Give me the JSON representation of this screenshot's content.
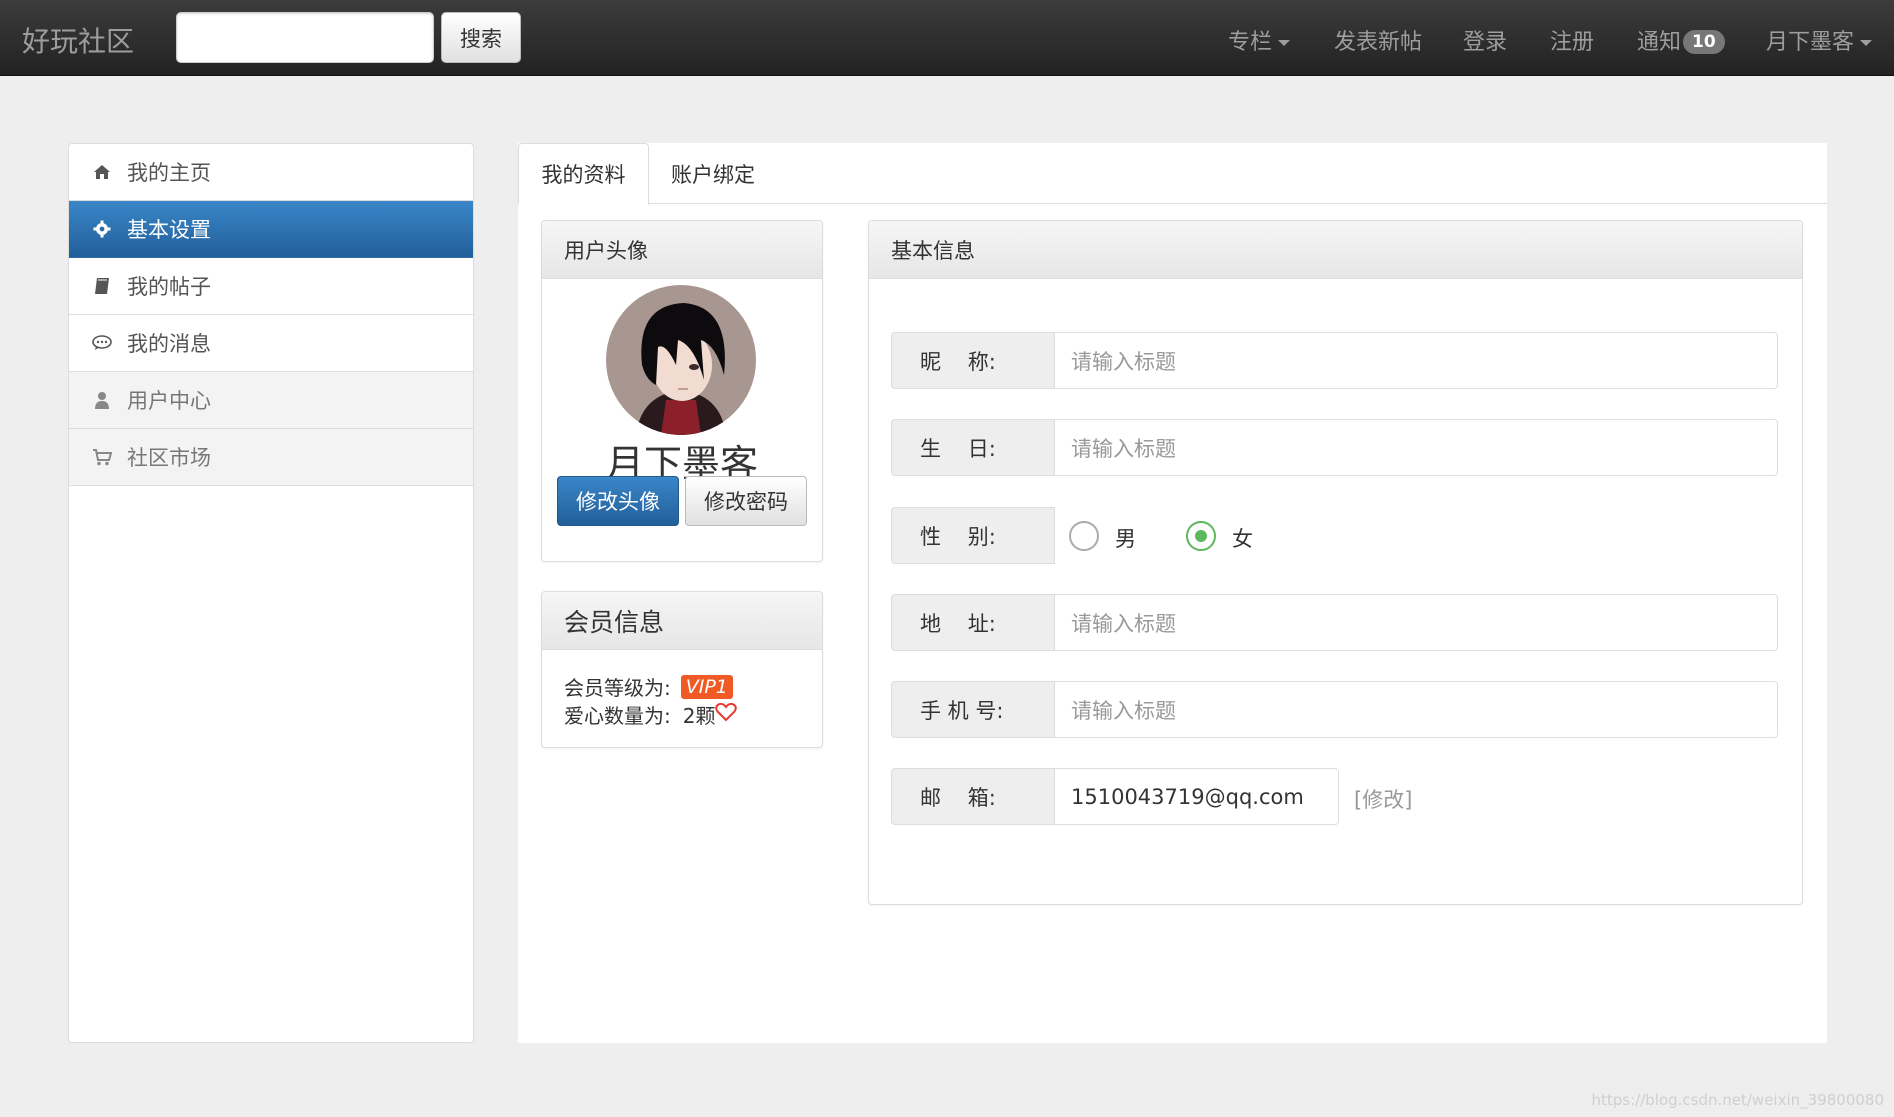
{
  "navbar": {
    "brand": "好玩社区",
    "search_value": "",
    "search_button": "搜索",
    "items": {
      "column": "专栏",
      "new_post": "发表新帖",
      "login": "登录",
      "register": "注册",
      "notify": "通知",
      "notify_count": "10",
      "user": "月下墨客"
    }
  },
  "sidebar": {
    "items": [
      {
        "label": "我的主页",
        "icon": "home-icon"
      },
      {
        "label": "基本设置",
        "icon": "gear-icon",
        "active": true
      },
      {
        "label": "我的帖子",
        "icon": "book-icon"
      },
      {
        "label": "我的消息",
        "icon": "comment-icon"
      },
      {
        "label": "用户中心",
        "icon": "user-icon"
      },
      {
        "label": "社区市场",
        "icon": "cart-icon"
      }
    ]
  },
  "tabs": [
    {
      "label": "我的资料",
      "active": true
    },
    {
      "label": "账户绑定"
    }
  ],
  "avatar_panel": {
    "title": "用户头像",
    "username": "月下墨客",
    "change_avatar": "修改头像",
    "change_password": "修改密码"
  },
  "member_panel": {
    "title": "会员信息",
    "level_label": "会员等级为:",
    "level_value": "VIP1",
    "hearts_label": "爱心数量为:",
    "hearts_value": "2颗"
  },
  "info_panel": {
    "title": "基本信息",
    "fields": {
      "nickname": {
        "label": "昵    称:",
        "placeholder": "请输入标题"
      },
      "birthday": {
        "label": "生    日:",
        "placeholder": "请输入标题"
      },
      "gender": {
        "label": "性    别:",
        "options": [
          "男",
          "女"
        ],
        "selected": "女"
      },
      "address": {
        "label": "地    址:",
        "placeholder": "请输入标题"
      },
      "phone": {
        "label": "手 机 号:",
        "placeholder": "请输入标题"
      },
      "email": {
        "label": "邮    箱:",
        "value": "1510043719@qq.com",
        "edit": "[修改]"
      }
    }
  },
  "watermark": "https://blog.csdn.net/weixin_39800080",
  "colors": {
    "primary": "#337ab7",
    "navbar": "#222222",
    "vip": "#f05a24",
    "radio_checked": "#5cb85c"
  }
}
